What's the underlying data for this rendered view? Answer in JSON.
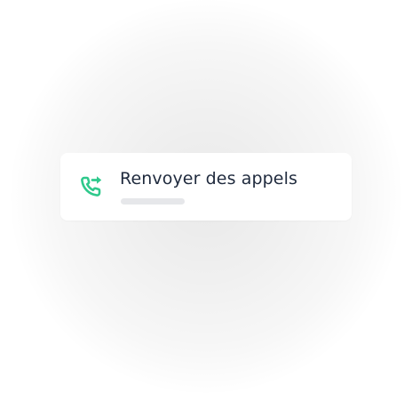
{
  "card": {
    "title": "Renvoyer des appels",
    "icon": "phone-forward-icon"
  },
  "colors": {
    "accent": "#2fc98c",
    "title_text": "#1f2a3d",
    "placeholder": "#e6e7ea"
  }
}
